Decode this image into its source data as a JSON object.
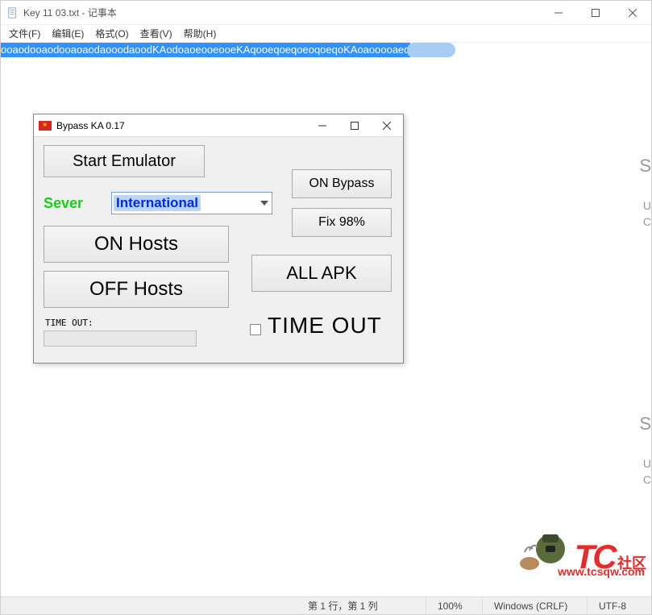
{
  "notepad": {
    "title": "Key 11 03.txt - 记事本",
    "menu": {
      "file": "文件(F)",
      "edit": "编辑(E)",
      "format": "格式(O)",
      "view": "查看(V)",
      "help": "帮助(H)"
    },
    "selected_text": "ooaodooaodooaoaodaooodaoodKAodoaoeooeooeKAqooeqoeqoeoqoeqoKAoaooooaeq",
    "status": {
      "pos": "第 1 行，第 1 列",
      "zoom": "100%",
      "eol": "Windows (CRLF)",
      "enc": "UTF-8"
    }
  },
  "bypass": {
    "title": "Bypass KA 0.17",
    "buttons": {
      "start_emulator": "Start Emulator",
      "on_bypass": "ON Bypass",
      "fix98": "Fix 98%",
      "on_hosts": "ON Hosts",
      "off_hosts": "OFF Hosts",
      "all_apk": "ALL APK"
    },
    "server_label": "Sever",
    "server_value": "International",
    "timeout_label": "TIME OUT:",
    "timeout_big": "TIME OUT"
  },
  "watermark": {
    "tc": "TC",
    "social": "社区",
    "url": "www.tcsqw.com"
  },
  "side_letters": {
    "a": "S",
    "b": "U",
    "c": "C",
    "d": "S",
    "e": "U",
    "f": "C"
  }
}
